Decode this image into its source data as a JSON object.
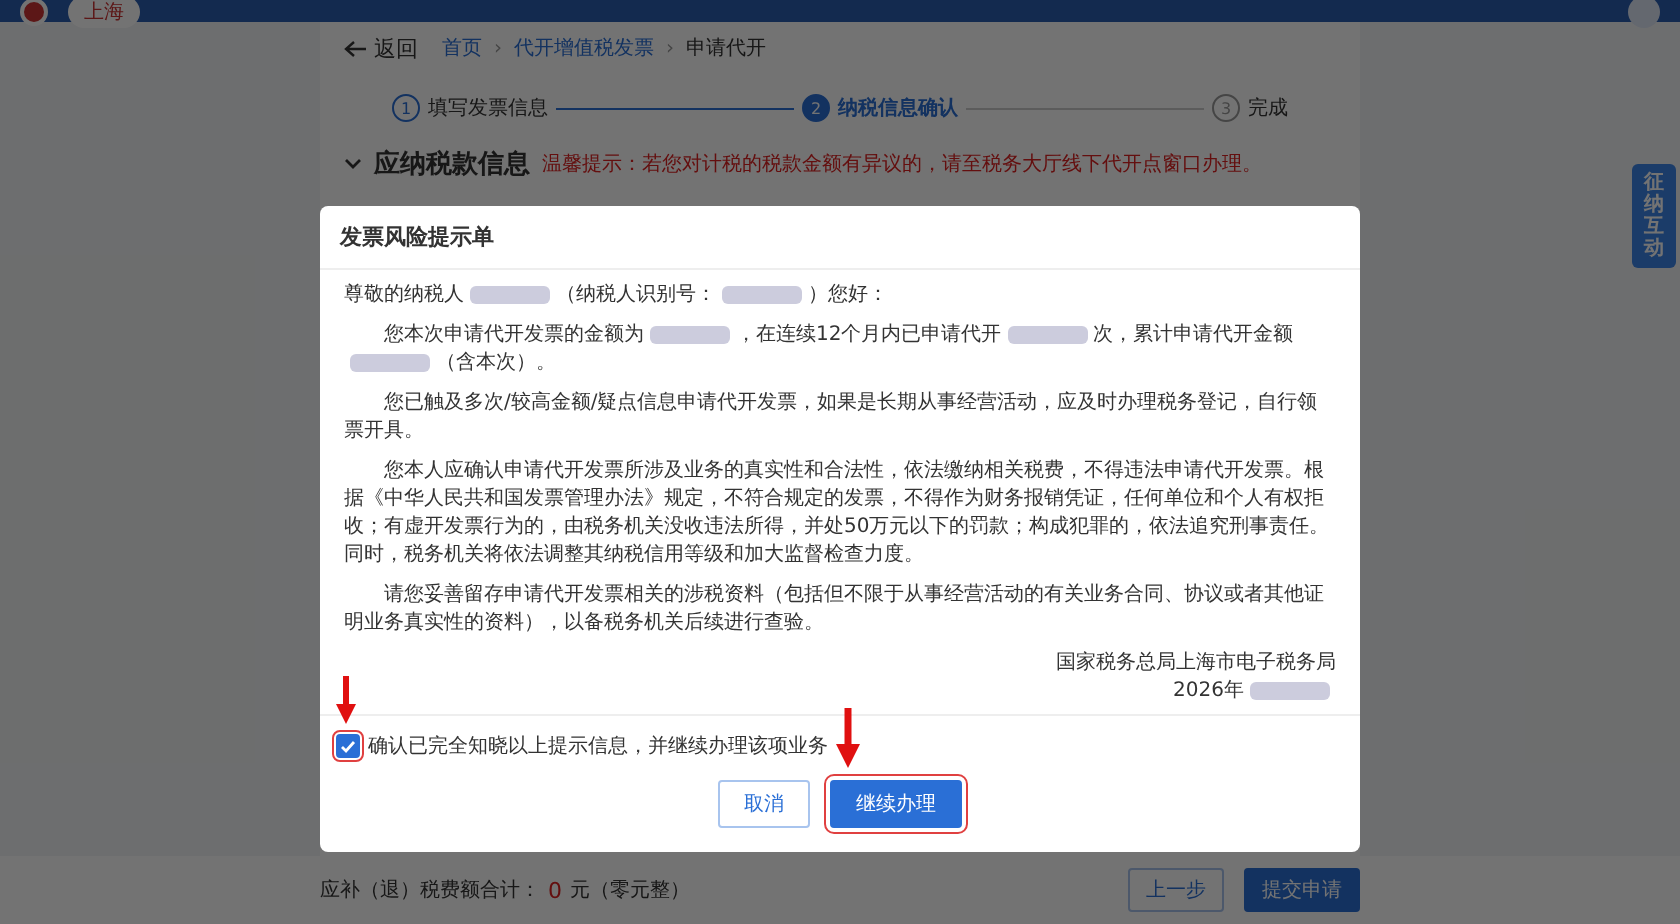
{
  "header": {
    "region_badge": "上海"
  },
  "breadcrumb": {
    "back": "返回",
    "separator": "›",
    "items": [
      "首页",
      "代开增值税发票",
      "申请代开"
    ]
  },
  "steps": [
    {
      "number": "1",
      "label": "填写发票信息",
      "selected": false,
      "completed": true
    },
    {
      "number": "2",
      "label": "纳税信息确认",
      "selected": true,
      "completed": false
    },
    {
      "number": "3",
      "label": "完成",
      "selected": false,
      "completed": false
    }
  ],
  "section": {
    "title": "应纳税款信息",
    "notice": "温馨提示：若您对计税的税款金额有异议的，请至税务大厅线下代开点窗口办理。"
  },
  "side_tab": "征纳互动",
  "dialog": {
    "title": "发票风险提示单",
    "greeting": [
      {
        "kind": "text",
        "text": "尊敬的纳税人"
      },
      {
        "kind": "redacted"
      },
      {
        "kind": "text",
        "text": "（纳税人识别号："
      },
      {
        "kind": "redacted"
      },
      {
        "kind": "text",
        "text": "）您好："
      }
    ],
    "paragraphs": [
      {
        "segments": [
          {
            "kind": "text",
            "text": "您本次申请代开发票的金额为"
          },
          {
            "kind": "redacted"
          },
          {
            "kind": "text",
            "text": "，在连续12个月内已申请代开"
          },
          {
            "kind": "redacted"
          },
          {
            "kind": "text",
            "text": "次，累计申请代开金额"
          },
          {
            "kind": "redacted"
          },
          {
            "kind": "text",
            "text": "（含本次）。"
          }
        ]
      },
      {
        "segments": [
          {
            "kind": "text",
            "text": "您已触及多次/较高金额/疑点信息申请代开发票，如果是长期从事经营活动，应及时办理税务登记，自行领票开具。"
          }
        ]
      },
      {
        "segments": [
          {
            "kind": "text",
            "text": "您本人应确认申请代开发票所涉及业务的真实性和合法性，依法缴纳相关税费，不得违法申请代开发票。根据《中华人民共和国发票管理办法》规定，不符合规定的发票，不得作为财务报销凭证，任何单位和个人有权拒收；有虚开发票行为的，由税务机关没收违法所得，并处50万元以下的罚款；构成犯罪的，依法追究刑事责任。同时，税务机关将依法调整其纳税信用等级和加大监督检查力度。"
          }
        ]
      },
      {
        "segments": [
          {
            "kind": "text",
            "text": "请您妥善留存申请代开发票相关的涉税资料（包括但不限于从事经营活动的有关业务合同、协议或者其他证明业务真实性的资料），以备税务机关后续进行查验。"
          }
        ]
      }
    ],
    "signature": "国家税务总局上海市电子税务局",
    "date": "2026年",
    "confirm": {
      "label": "确认已完全知晓以上提示信息，并继续办理该项业务",
      "checked": true
    },
    "buttons": [
      {
        "label": "取消",
        "kind": "secondary"
      },
      {
        "label": "继续办理",
        "kind": "primary"
      }
    ]
  },
  "footer": {
    "total_label": "应补（退）税费额合计：",
    "total_value": "0",
    "total_unit": "元（零元整）",
    "buttons": [
      {
        "label": "上一步",
        "kind": "secondary"
      },
      {
        "label": "提交申请",
        "kind": "primary"
      }
    ]
  }
}
